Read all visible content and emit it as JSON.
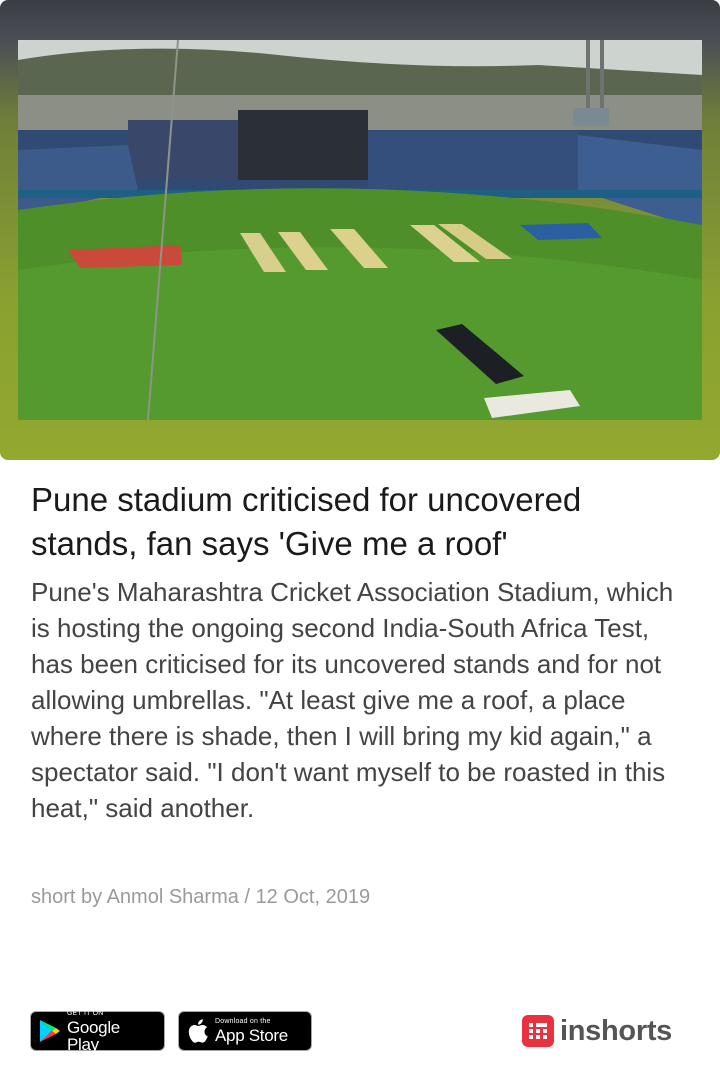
{
  "article": {
    "title": "Pune stadium criticised for uncovered stands, fan says 'Give me a roof'",
    "body": "Pune's Maharashtra Cricket Association Stadium, which is hosting the ongoing second India-South Africa Test, has been criticised for its uncovered stands and for not allowing umbrellas. \"At least give me a roof, a place where there is shade, then I will bring my kid again,\" a spectator said. \"I don't want myself to be roasted in this heat,\" said another.",
    "byline": "short by Anmol Sharma / 12 Oct, 2019",
    "image_icon": "stadium-photo"
  },
  "footer": {
    "google_play": {
      "small": "GET IT ON",
      "big": "Google Play",
      "icon": "play-store-icon"
    },
    "app_store": {
      "small": "Download on the",
      "big": "App Store",
      "icon": "apple-icon"
    },
    "brand": {
      "name": "inshorts",
      "icon": "inshorts-logo-icon",
      "color": "#e8323f"
    }
  }
}
